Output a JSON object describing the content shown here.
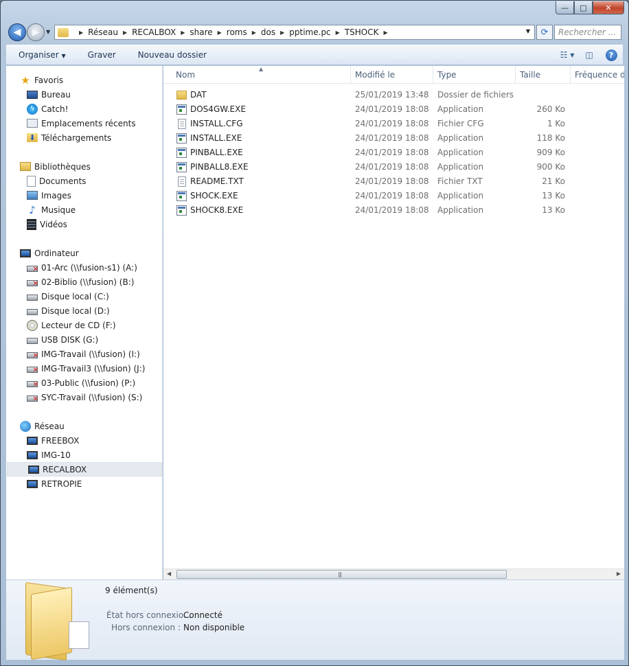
{
  "window": {
    "caption_min": "—",
    "caption_max": "□",
    "caption_close": "✕"
  },
  "nav": {
    "breadcrumb": [
      "Réseau",
      "RECALBOX",
      "share",
      "roms",
      "dos",
      "pptime.pc",
      "TSHOCK"
    ],
    "search_placeholder": "Rechercher ..."
  },
  "toolbar": {
    "organize": "Organiser",
    "burn": "Graver",
    "new_folder": "Nouveau dossier"
  },
  "sidebar": {
    "favorites": {
      "label": "Favoris",
      "items": [
        {
          "label": "Bureau",
          "icon": "desktop-icon"
        },
        {
          "label": "Catch!",
          "icon": "catch-icon"
        },
        {
          "label": "Emplacements récents",
          "icon": "recent-places-icon"
        },
        {
          "label": "Téléchargements",
          "icon": "downloads-icon"
        }
      ]
    },
    "libraries": {
      "label": "Bibliothèques",
      "items": [
        {
          "label": "Documents",
          "icon": "documents-icon"
        },
        {
          "label": "Images",
          "icon": "pictures-icon"
        },
        {
          "label": "Musique",
          "icon": "music-icon"
        },
        {
          "label": "Vidéos",
          "icon": "videos-icon"
        }
      ]
    },
    "computer": {
      "label": "Ordinateur",
      "items": [
        {
          "label": "01-Arc (\\\\fusion-s1) (A:)",
          "icon": "network-drive-disconnected-icon"
        },
        {
          "label": "02-Biblio (\\\\fusion) (B:)",
          "icon": "network-drive-disconnected-icon"
        },
        {
          "label": "Disque local (C:)",
          "icon": "windows-drive-icon"
        },
        {
          "label": "Disque local (D:)",
          "icon": "hard-drive-icon"
        },
        {
          "label": "Lecteur de CD (F:)",
          "icon": "cd-drive-icon"
        },
        {
          "label": "USB DISK (G:)",
          "icon": "usb-drive-icon"
        },
        {
          "label": "IMG-Travail (\\\\fusion) (I:)",
          "icon": "network-drive-disconnected-icon"
        },
        {
          "label": "IMG-Travail3 (\\\\fusion) (J:)",
          "icon": "network-drive-disconnected-icon"
        },
        {
          "label": "03-Public (\\\\fusion) (P:)",
          "icon": "network-drive-disconnected-icon"
        },
        {
          "label": "SYC-Travail (\\\\fusion) (S:)",
          "icon": "network-drive-disconnected-icon"
        }
      ]
    },
    "network": {
      "label": "Réseau",
      "items": [
        {
          "label": "FREEBOX",
          "icon": "network-computer-icon"
        },
        {
          "label": "IMG-10",
          "icon": "network-computer-icon"
        },
        {
          "label": "RECALBOX",
          "icon": "network-computer-icon",
          "selected": true
        },
        {
          "label": "RETROPIE",
          "icon": "network-computer-icon"
        }
      ]
    }
  },
  "columns": {
    "name": "Nom",
    "modified": "Modifié le",
    "type": "Type",
    "size": "Taille",
    "frequency": "Fréquence d'i"
  },
  "files": [
    {
      "name": "DAT",
      "modified": "25/01/2019 13:48",
      "type": "Dossier de fichiers",
      "size": "",
      "icon": "folder-icon"
    },
    {
      "name": "DOS4GW.EXE",
      "modified": "24/01/2019 18:08",
      "type": "Application",
      "size": "260 Ko",
      "icon": "application-icon"
    },
    {
      "name": "INSTALL.CFG",
      "modified": "24/01/2019 18:08",
      "type": "Fichier CFG",
      "size": "1 Ko",
      "icon": "file-icon"
    },
    {
      "name": "INSTALL.EXE",
      "modified": "24/01/2019 18:08",
      "type": "Application",
      "size": "118 Ko",
      "icon": "application-icon"
    },
    {
      "name": "PINBALL.EXE",
      "modified": "24/01/2019 18:08",
      "type": "Application",
      "size": "909 Ko",
      "icon": "application-icon"
    },
    {
      "name": "PINBALL8.EXE",
      "modified": "24/01/2019 18:08",
      "type": "Application",
      "size": "900 Ko",
      "icon": "application-icon"
    },
    {
      "name": "README.TXT",
      "modified": "24/01/2019 18:08",
      "type": "Fichier TXT",
      "size": "21 Ko",
      "icon": "text-file-icon"
    },
    {
      "name": "SHOCK.EXE",
      "modified": "24/01/2019 18:08",
      "type": "Application",
      "size": "13 Ko",
      "icon": "application-icon"
    },
    {
      "name": "SHOCK8.EXE",
      "modified": "24/01/2019 18:08",
      "type": "Application",
      "size": "13 Ko",
      "icon": "application-icon"
    }
  ],
  "details": {
    "count": "9 élément(s)",
    "offline_status_label": "État hors connexio...",
    "offline_status_value": "Connecté",
    "offline_label": "Hors connexion :",
    "offline_value": "Non disponible"
  }
}
